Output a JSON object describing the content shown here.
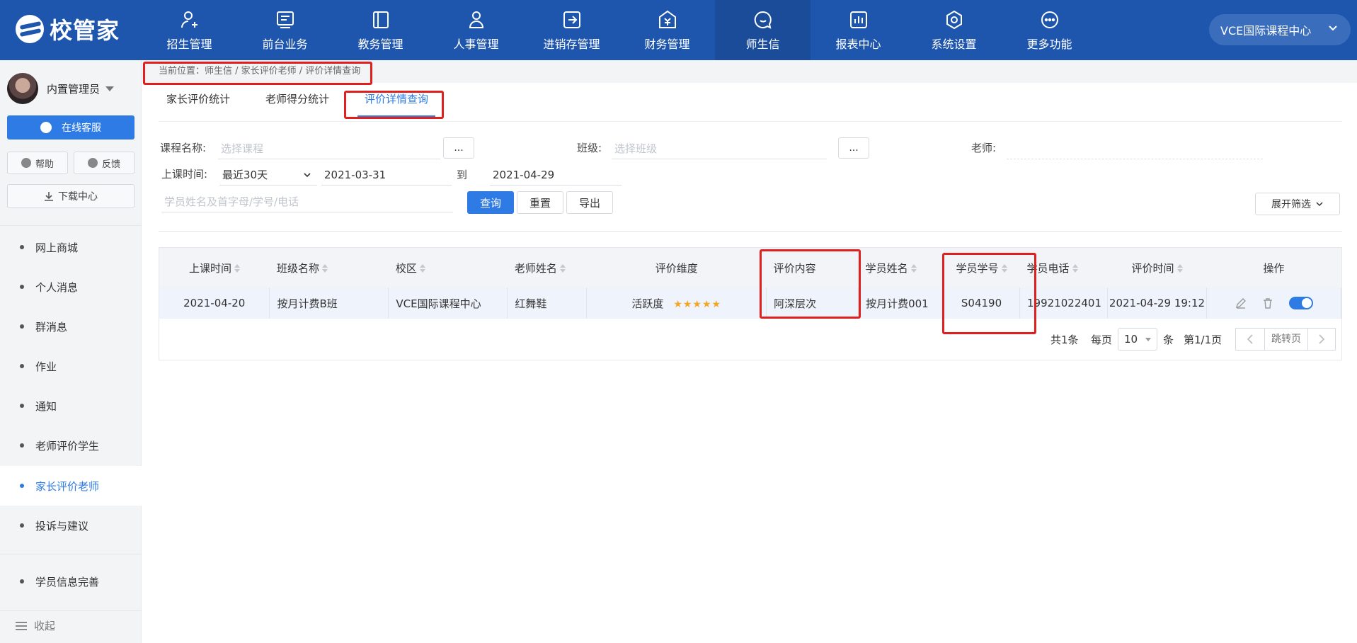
{
  "app": {
    "logo_text": "校管家",
    "campus": "VCE国际课程中心"
  },
  "nav": [
    {
      "label": "招生管理",
      "icon": "user-add-icon"
    },
    {
      "label": "前台业务",
      "icon": "monitor-icon"
    },
    {
      "label": "教务管理",
      "icon": "book-icon"
    },
    {
      "label": "人事管理",
      "icon": "person-icon"
    },
    {
      "label": "进销存管理",
      "icon": "inventory-icon"
    },
    {
      "label": "财务管理",
      "icon": "finance-icon"
    },
    {
      "label": "师生信",
      "icon": "chat-icon"
    },
    {
      "label": "报表中心",
      "icon": "report-icon"
    },
    {
      "label": "系统设置",
      "icon": "settings-icon"
    },
    {
      "label": "更多功能",
      "icon": "more-icon"
    }
  ],
  "active_nav": "师生信",
  "sidebar": {
    "user_name": "内置管理员",
    "service_label": "在线客服",
    "help_label": "帮助",
    "feedback_label": "反馈",
    "download_label": "下载中心",
    "items": [
      {
        "label": "网上商城"
      },
      {
        "label": "个人消息"
      },
      {
        "label": "群消息"
      },
      {
        "label": "作业"
      },
      {
        "label": "通知"
      },
      {
        "label": "老师评价学生"
      },
      {
        "label": "家长评价老师"
      },
      {
        "label": "投诉与建议"
      }
    ],
    "extra_item": "学员信息完善",
    "active_item": "家长评价老师",
    "collapse_label": "收起"
  },
  "breadcrumb": "当前位置：师生信 / 家长评价老师 / 评价详情查询",
  "tabs": [
    {
      "label": "家长评价统计"
    },
    {
      "label": "老师得分统计"
    },
    {
      "label": "评价详情查询"
    }
  ],
  "active_tab": "评价详情查询",
  "filters": {
    "course_label": "课程名称:",
    "course_placeholder": "选择课程",
    "class_label": "班级:",
    "class_placeholder": "选择班级",
    "teacher_label": "老师:",
    "dots": "...",
    "time_label": "上课时间:",
    "range_value": "最近30天",
    "date_from": "2021-03-31",
    "to_label": "到",
    "date_to": "2021-04-29",
    "student_placeholder": "学员姓名及首字母/学号/电话",
    "query_btn": "查询",
    "reset_btn": "重置",
    "export_btn": "导出",
    "expand_btn": "展开筛选"
  },
  "table": {
    "headers": [
      "上课时间",
      "班级名称",
      "校区",
      "老师姓名",
      "评价维度",
      "评价内容",
      "学员姓名",
      "学员学号",
      "学员电话",
      "评价时间",
      "操作"
    ],
    "rows": [
      {
        "class_time": "2021-04-20",
        "class_name": "按月计费B班",
        "campus": "VCE国际课程中心",
        "teacher": "红舞鞋",
        "dimension": "活跃度",
        "stars": "★★★★★",
        "content": "阿深层次",
        "student_name": "按月计费001",
        "student_no": "S04190",
        "phone": "19921022401",
        "eval_time": "2021-04-29 19:12"
      }
    ]
  },
  "pagination": {
    "total": "共1条",
    "per_page_label": "每页",
    "per_page": "10",
    "unit": "条",
    "page_info": "第1/1页",
    "jump_placeholder": "跳转页"
  },
  "colors": {
    "brand": "#1f56ad",
    "accent": "#2f7be5",
    "highlight": "#e0201f",
    "star": "#f5a623"
  }
}
